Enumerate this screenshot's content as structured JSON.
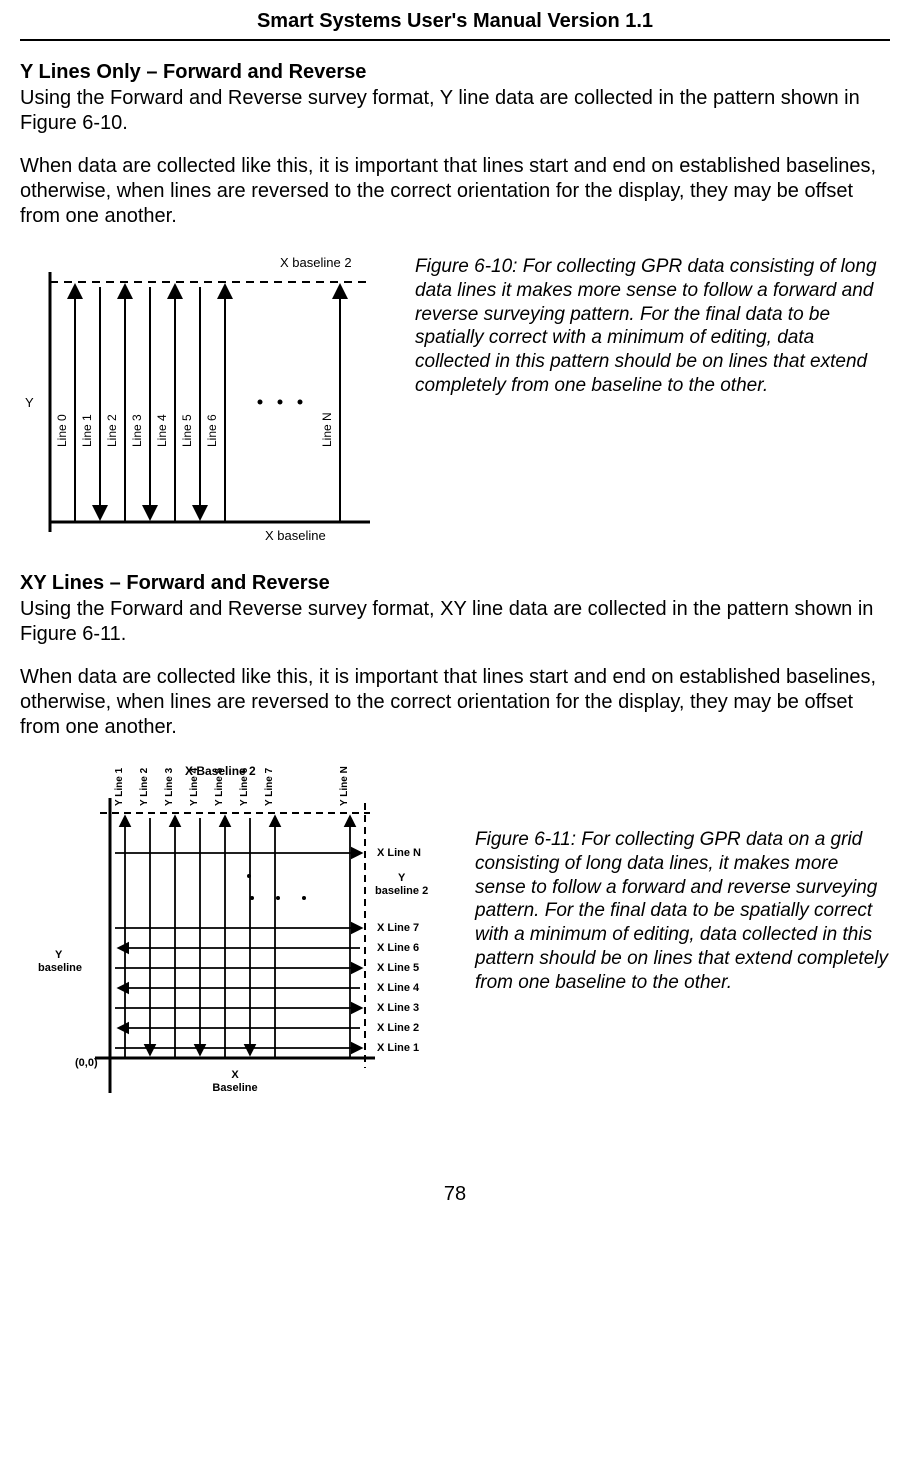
{
  "header": {
    "title": "Smart Systems User's Manual Version 1.1"
  },
  "section1": {
    "title": "Y Lines Only – Forward and Reverse",
    "p1": "Using the Forward and Reverse survey format, Y line data are collected in the pattern shown in Figure 6-10.",
    "p2": "When data are collected like this, it is important that lines start and end on established baselines, otherwise, when lines are reversed to the correct orientation for the display, they may be offset from one another."
  },
  "fig1": {
    "caption": "Figure 6-10: For collecting GPR data consisting of long data lines it makes more sense to follow a forward and reverse surveying pattern. For the final data to be spatially correct with a minimum of editing, data collected in this pattern should be on lines that extend completely from one baseline to the other.",
    "labels": {
      "topBaseline": "X  baseline 2",
      "bottomBaseline": "X  baseline",
      "yAxis": "Y",
      "lines": [
        "Line 0",
        "Line 1",
        "Line 2",
        "Line 3",
        "Line 4",
        "Line 5",
        "Line 6",
        "Line N"
      ]
    }
  },
  "section2": {
    "title": "XY Lines – Forward and Reverse",
    "p1": "Using the Forward and Reverse survey format, XY line data are collected in the pattern shown in Figure 6-11.",
    "p2": "When data are collected like this, it is important that lines start and end on established baselines, otherwise, when lines are reversed to the correct orientation for the display, they may be offset from one another."
  },
  "fig2": {
    "caption": "Figure 6-11: For collecting GPR data on a grid consisting of long data lines, it makes more sense to follow a forward and reverse surveying pattern. For the final data to be spatially correct with a minimum of editing, data collected in this pattern should be on lines that extend completely from one baseline to the other.",
    "labels": {
      "topBaseline": "X Baseline 2",
      "bottomBaseline": "X\nBaseline",
      "leftLabel": "Y\nbaseline",
      "rightLabel": "Y\nbaseline 2",
      "origin": "(0,0)",
      "yLines": [
        "Y Line 1",
        "Y Line 2",
        "Y Line 3",
        "Y Line 4",
        "Y Line 5",
        "Y Line 6",
        "Y Line 7",
        "Y Line N"
      ],
      "xLines": [
        "X Line 1",
        "X Line 2",
        "X Line 3",
        "X Line 4",
        "X Line 5",
        "X Line 6",
        "X Line 7",
        "X Line N"
      ]
    }
  },
  "pageNumber": "78"
}
